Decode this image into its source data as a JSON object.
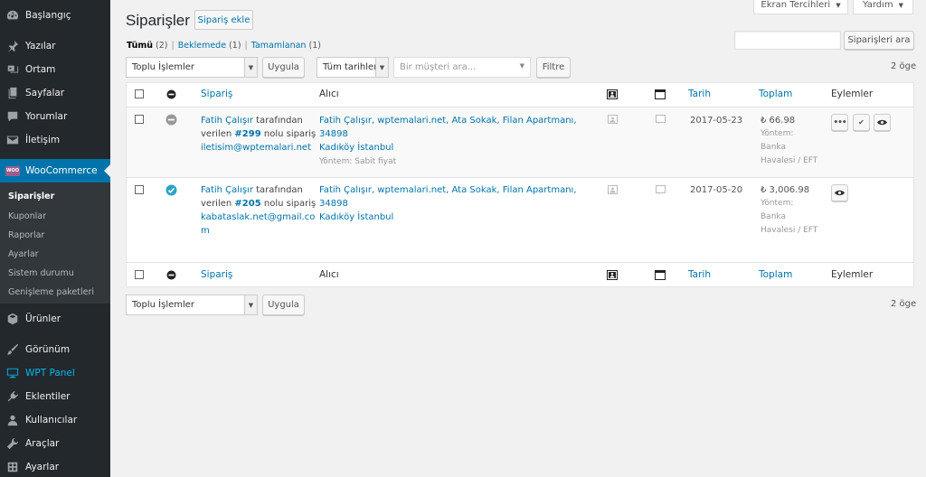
{
  "sidebar": {
    "items": [
      {
        "label": "Başlangıç",
        "icon": "dashboard-icon"
      },
      {
        "label": "Yazılar",
        "icon": "pin-icon"
      },
      {
        "label": "Ortam",
        "icon": "media-icon"
      },
      {
        "label": "Sayfalar",
        "icon": "pages-icon"
      },
      {
        "label": "Yorumlar",
        "icon": "comments-icon"
      },
      {
        "label": "İletişim",
        "icon": "mail-icon"
      },
      {
        "label": "WooCommerce",
        "icon": "woocommerce-icon"
      },
      {
        "label": "Ürünler",
        "icon": "products-icon"
      },
      {
        "label": "Görünüm",
        "icon": "brush-icon"
      },
      {
        "label": "WPT Panel",
        "icon": "monitor-icon"
      },
      {
        "label": "Eklentiler",
        "icon": "plugin-icon"
      },
      {
        "label": "Kullanıcılar",
        "icon": "users-icon"
      },
      {
        "label": "Araçlar",
        "icon": "wrench-icon"
      },
      {
        "label": "Ayarlar",
        "icon": "settings-icon"
      }
    ],
    "woo_badge": "WOO",
    "submenu": [
      "Siparişler",
      "Kuponlar",
      "Raporlar",
      "Ayarlar",
      "Sistem durumu",
      "Genişleme paketleri"
    ],
    "colors": {
      "bg": "#23282d",
      "active": "#0073aa",
      "highlight": "#00b9eb"
    }
  },
  "header": {
    "screen_options": "Ekran Tercihleri",
    "help": "Yardım",
    "title": "Siparişler",
    "add_button": "Sipariş ekle"
  },
  "filters": {
    "all": "Tümü",
    "all_count": "(2)",
    "pending": "Beklemede",
    "pending_count": "(1)",
    "completed": "Tamamlanan",
    "completed_count": "(1)",
    "separator": "|",
    "search_button": "Siparişleri ara",
    "bulk_actions": "Toplu İşlemler",
    "apply": "Uygula",
    "all_dates": "Tüm tarihler",
    "customer_placeholder": "Bir müşteri ara...",
    "filter_button": "Filtre",
    "item_count": "2 öge"
  },
  "table": {
    "columns": {
      "order": "Sipariş",
      "ship_to": "Alıcı",
      "date": "Tarih",
      "total": "Toplam",
      "actions": "Eylemler"
    },
    "rows": [
      {
        "status": "on-hold",
        "customer": "Fatih Çalışır",
        "by": "tarafından",
        "given": "verilen",
        "order_no": "#299",
        "order_suffix": "nolu sipariş",
        "email": "iletisim@wptemalari.net",
        "address_line1": "Fatih Çalışır, wptemalari.net, Ata Sokak, Filan Apartmanı, 34898",
        "address_line2": "Kadıköy İstanbul",
        "shipping_method": "Yöntem: Sabit fiyat",
        "date": "2017-05-23",
        "total": "₺ 66.98",
        "payment": [
          "Yöntem:",
          "Banka",
          "Havalesi / EFT"
        ]
      },
      {
        "status": "completed",
        "customer": "Fatih Çalışır",
        "by": "tarafından",
        "given": "verilen",
        "order_no": "#205",
        "order_suffix": "nolu sipariş",
        "email_line1": "kabataslak.net@gmail.co",
        "email_line2": "m",
        "address_line1": "Fatih Çalışır, wptemalari.net, Ata Sokak, Filan Apartmanı, 34898",
        "address_line2": "Kadıköy İstanbul",
        "date": "2017-05-20",
        "total": "₺ 3,006.98",
        "payment": [
          "Yöntem:",
          "Banka",
          "Havalesi / EFT"
        ]
      }
    ]
  }
}
